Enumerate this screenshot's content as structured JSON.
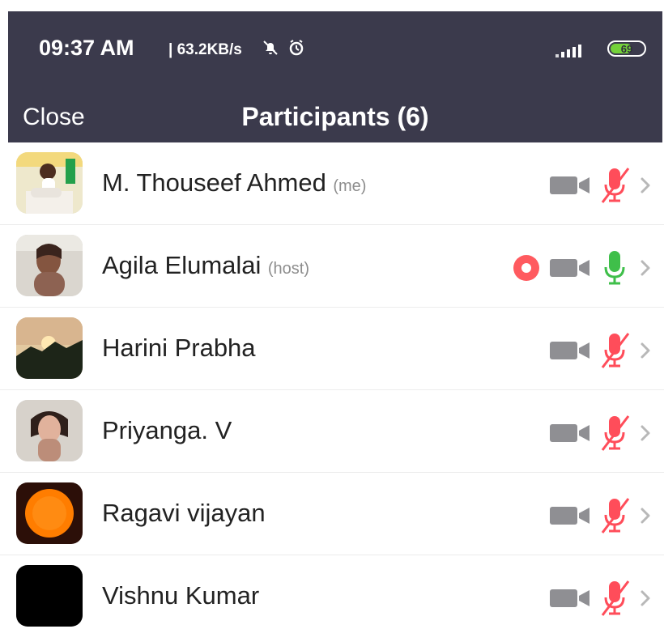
{
  "status_bar": {
    "time": "09:37 AM",
    "speed": "| 63.2KB/s",
    "mute_icon": "bell-mute-icon",
    "alarm_icon": "alarm-icon",
    "signal_icon": "signal-icon",
    "battery_level": "69",
    "battery_color": "#74d13a"
  },
  "header": {
    "close_label": "Close",
    "title": "Participants (6)",
    "background": "#3b3a4c"
  },
  "participants": [
    {
      "name": "M. Thouseef Ahmed",
      "tag": "(me)",
      "recording": false,
      "video_off": true,
      "mic_muted": true
    },
    {
      "name": "Agila Elumalai",
      "tag": "(host)",
      "recording": true,
      "video_off": true,
      "mic_muted": false
    },
    {
      "name": "Harini Prabha",
      "tag": "",
      "recording": false,
      "video_off": true,
      "mic_muted": true
    },
    {
      "name": "Priyanga. V",
      "tag": "",
      "recording": false,
      "video_off": true,
      "mic_muted": true
    },
    {
      "name": "Ragavi vijayan",
      "tag": "",
      "recording": false,
      "video_off": true,
      "mic_muted": true
    },
    {
      "name": "Vishnu Kumar",
      "tag": "",
      "recording": false,
      "video_off": true,
      "mic_muted": true
    }
  ],
  "colors": {
    "muted_mic": "#ff4d5a",
    "live_mic": "#3fbf4a",
    "video_icon": "#8f8f93",
    "record": "#ff5a5f",
    "chevron": "#b8b8b8"
  }
}
